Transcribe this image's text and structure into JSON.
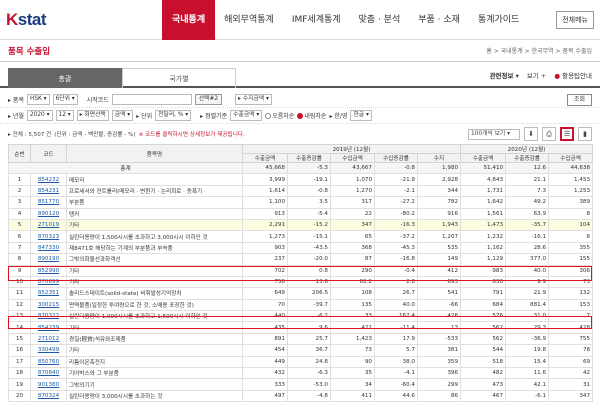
{
  "header": {
    "logo_k": "K",
    "logo_rest": "stat",
    "nav": [
      "국내통계",
      "해외무역통계",
      "IMF세계통계",
      "맞춤 · 분석",
      "부품 · 소재",
      "통계가이드"
    ],
    "all_menu": "전체메뉴"
  },
  "page": {
    "title": "품목 수출입",
    "breadcrumb": "홈 > 국내통계 > 한국무역 > 품목 수출입"
  },
  "tabs": {
    "t1": "총괄",
    "t2": "국가별"
  },
  "tools": {
    "related": "관련정보",
    "view": "보기",
    "fav": "활용팁안내"
  },
  "filter1": {
    "label": "품목",
    "cls": "HSK",
    "digits": "6단위",
    "code_label": "시작코드",
    "select": "선택#2",
    "amount": "수지금액",
    "q": "조회"
  },
  "filter2": {
    "label": "년월",
    "year": "2020",
    "month": "12",
    "period": "화면선택",
    "sort": "금액",
    "unit_label": "단위",
    "unit": "천달러, %",
    "sort_label": "정렬기준",
    "sort_val": "수출금액",
    "opt1": "오름차순",
    "opt2": "내림차순",
    "lang": "한/영",
    "lang_val": "한글"
  },
  "info": {
    "count_label": "전체 : 5,507 건",
    "unit_text": "(단위 : 금액 - 백만불, 증감률 - %)",
    "note": "코드를 클릭하시면 상세정보가 제공됩니다.",
    "perpage": "100개씩 보기"
  },
  "table": {
    "h_rank": "순번",
    "h_code": "코드",
    "h_name": "품목명",
    "y1": "2019년 (12월)",
    "y2": "2020년 (12월)",
    "sub": [
      "수출금액",
      "수출증감률",
      "수입금액",
      "수입증감률",
      "수지",
      "수출금액",
      "수출증감률",
      "수입금액"
    ],
    "total": {
      "label": "총계",
      "v": [
        "45,668",
        "-5.3",
        "43,667",
        "-0.8",
        "1,980",
        "51,410",
        "12.6",
        "44,638"
      ]
    },
    "rows": [
      {
        "no": "1",
        "code": "854232",
        "name": "메모리",
        "v": [
          "3,999",
          "-19.1",
          "1,070",
          "-21.9",
          "2,928",
          "4,843",
          "21.1",
          "1,453"
        ]
      },
      {
        "no": "2",
        "code": "854231",
        "name": "프로세서와 컨트롤러(메모리 · 변환기 · 논리회로 · 증폭기 ·",
        "v": [
          "1,614",
          "-0.8",
          "1,270",
          "-2.1",
          "344",
          "1,731",
          "7.3",
          "1,253"
        ]
      },
      {
        "no": "3",
        "code": "851770",
        "name": "부분품",
        "v": [
          "1,100",
          "3.5",
          "317",
          "-27.2",
          "782",
          "1,642",
          "49.2",
          "389"
        ]
      },
      {
        "no": "4",
        "code": "890120",
        "name": "탱커",
        "v": [
          "913",
          "-5.4",
          "22",
          "-80.2",
          "916",
          "1,561",
          "63.9",
          "8"
        ]
      },
      {
        "no": "5",
        "code": "271019",
        "name": "기타",
        "v": [
          "2,291",
          "-15.2",
          "347",
          "-16.3",
          "1,943",
          "1,473",
          "-35.7",
          "104"
        ]
      },
      {
        "no": "6",
        "code": "870323",
        "name": "실린더용량이 1,500시시를 초과하고 3,000시시 이하인 것",
        "v": [
          "1,273",
          "-15.1",
          "65",
          "-37.2",
          "1,207",
          "1,232",
          "-16.1",
          "6"
        ]
      },
      {
        "no": "7",
        "code": "847330",
        "name": "제8471호 해당하는 기계의 부분품과 부속품",
        "v": [
          "903",
          "-43.5",
          "368",
          "-45.3",
          "535",
          "1,162",
          "28.6",
          "355"
        ]
      },
      {
        "no": "8",
        "code": "890190",
        "name": "그밖의화물선과화객선",
        "v": [
          "237",
          "-20.0",
          "87",
          "-16.8",
          "149",
          "1,129",
          "377.0",
          "155"
        ]
      },
      {
        "no": "9",
        "code": "852990",
        "name": "기타",
        "v": [
          "702",
          "0.8",
          "290",
          "-0.4",
          "412",
          "983",
          "40.0",
          "306"
        ]
      },
      {
        "no": "10",
        "code": "870899",
        "name": "기타",
        "v": [
          "756",
          "13.6",
          "62.2",
          "2.8",
          "693",
          "830",
          "9.9",
          "73"
        ]
      },
      {
        "no": "11",
        "code": "852351",
        "name": "솔리드스테이트(solid-state) 비휘발성기억장치",
        "v": [
          "649",
          "206.5",
          "108",
          "26.7",
          "541",
          "791",
          "21.9",
          "132"
        ]
      },
      {
        "no": "12",
        "code": "300215",
        "name": "면역물품(일정한 투여량으로 한 것, 소매용 포장한 것)",
        "v": [
          "70",
          "-39.7",
          "135",
          "40.0",
          "-66",
          "684",
          "881.4",
          "153"
        ]
      },
      {
        "no": "13",
        "code": "870322",
        "name": "실린더용량이 1,000시시를 초과하고 1,500시시 이하인 것",
        "v": [
          "440",
          "-6.2",
          "33",
          "162.4",
          "426",
          "576",
          "31.0",
          "7"
        ]
      },
      {
        "no": "14",
        "code": "854239",
        "name": "기타",
        "v": [
          "435",
          "9.6",
          "422",
          "-11.4",
          "13",
          "562",
          "29.3",
          "428"
        ]
      },
      {
        "no": "15",
        "code": "271012",
        "name": "경질(輕質)석유와조제품",
        "v": [
          "891",
          "25.7",
          "1,423",
          "17.9",
          "-533",
          "562",
          "-36.9",
          "755"
        ]
      },
      {
        "no": "16",
        "code": "330499",
        "name": "기타",
        "v": [
          "454",
          "36.7",
          "73",
          "5.7",
          "381",
          "544",
          "19.8",
          "78"
        ]
      },
      {
        "no": "17",
        "code": "850760",
        "name": "리튬이온축전지",
        "v": [
          "449",
          "24.8",
          "90",
          "38.0",
          "359",
          "518",
          "15.4",
          "69"
        ]
      },
      {
        "no": "18",
        "code": "870840",
        "name": "기어박스와 그 부분품",
        "v": [
          "432",
          "-6.3",
          "35",
          "-4.1",
          "396",
          "482",
          "11.6",
          "42"
        ]
      },
      {
        "no": "19",
        "code": "901380",
        "name": "그밖의기기",
        "v": [
          "333",
          "-53.0",
          "34",
          "-60.4",
          "299",
          "473",
          "42.1",
          "31"
        ]
      },
      {
        "no": "20",
        "code": "870324",
        "name": "실린더용량이 3,000시시를 초과하는 것",
        "v": [
          "497",
          "-4.8",
          "411",
          "44.6",
          "86",
          "467",
          "-6.1",
          "347"
        ]
      }
    ]
  }
}
